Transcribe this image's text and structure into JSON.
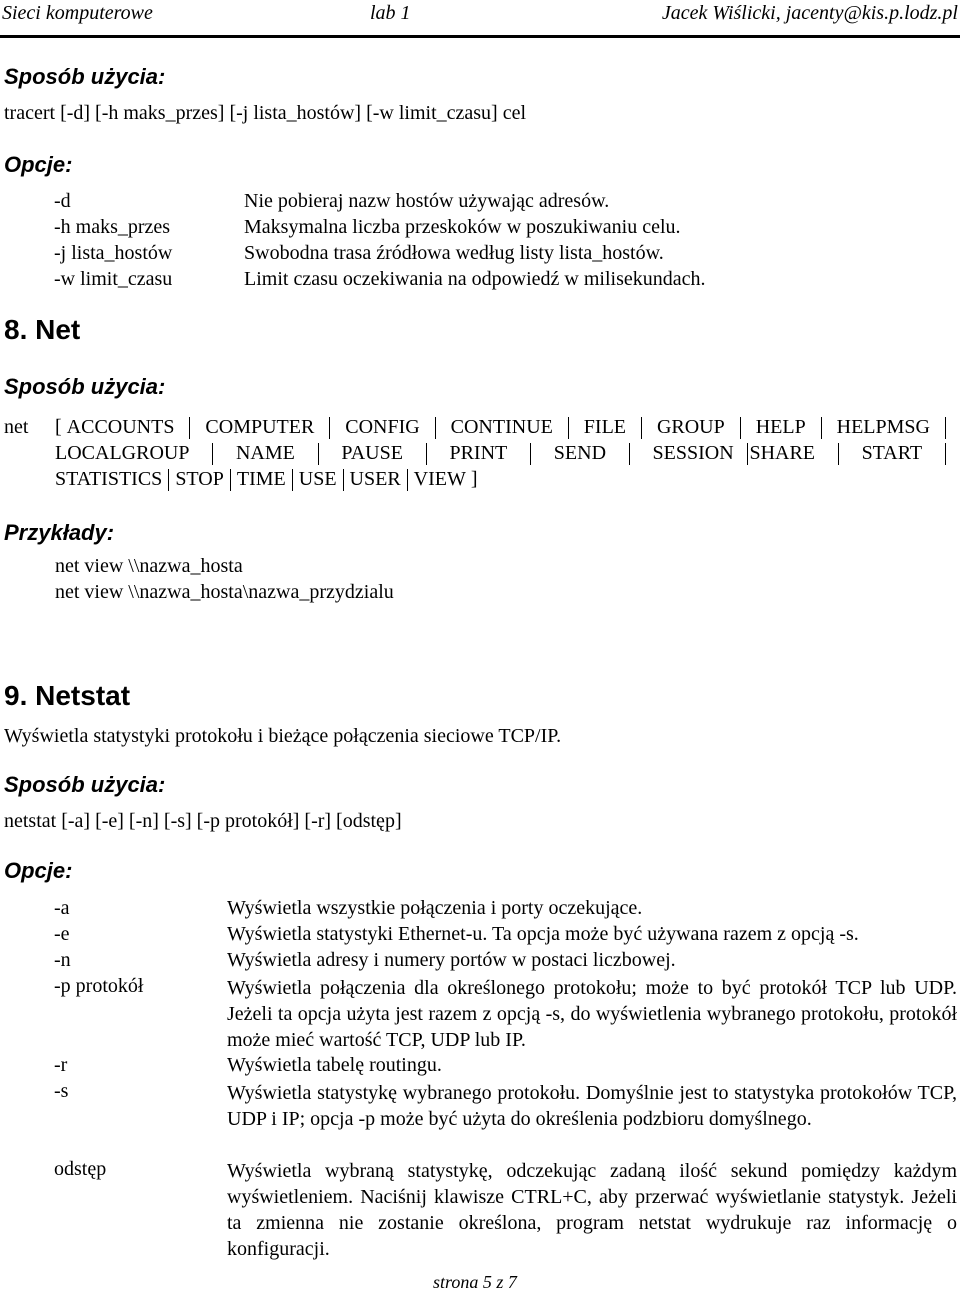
{
  "header": {
    "course": "Sieci komputerowe",
    "lab": "lab 1",
    "author": "Jacek Wiślicki, jacenty@kis.p.lodz.pl"
  },
  "tracert": {
    "usage_heading": "Sposób użycia:",
    "usage": "tracert [-d] [-h maks_przes] [-j lista_hostów] [-w limit_czasu] cel",
    "options_heading": "Opcje:",
    "options": [
      {
        "flag": "-d",
        "desc": "Nie pobieraj nazw hostów używając adresów."
      },
      {
        "flag": "-h maks_przes",
        "desc": "Maksymalna liczba przeskoków w poszukiwaniu celu."
      },
      {
        "flag": "-j lista_hostów",
        "desc": "Swobodna trasa źródłowa według listy lista_hostów."
      },
      {
        "flag": "-w limit_czasu",
        "desc": "Limit czasu oczekiwania na odpowiedź w milisekundach."
      }
    ]
  },
  "net": {
    "title": "8. Net",
    "usage_heading": "Sposób użycia:",
    "command": "net",
    "open_bracket": "[",
    "close_bracket": "]",
    "subcommands": [
      "ACCOUNTS",
      "COMPUTER",
      "CONFIG",
      "CONTINUE",
      "FILE",
      "GROUP",
      "HELP",
      "HELPMSG",
      "LOCALGROUP",
      "NAME",
      "PAUSE",
      "PRINT",
      "SEND",
      "SESSION",
      "SHARE",
      "START",
      "STATISTICS",
      "STOP",
      "TIME",
      "USE",
      "USER",
      "VIEW"
    ],
    "examples_heading": "Przykłady:",
    "examples": [
      "net view \\\\nazwa_hosta",
      "net view \\\\nazwa_hosta\\nazwa_przydzialu"
    ]
  },
  "netstat": {
    "title": "9. Netstat",
    "description": "Wyświetla statystyki protokołu i bieżące połączenia sieciowe TCP/IP.",
    "usage_heading": "Sposób użycia:",
    "usage": "netstat [-a] [-e] [-n] [-s] [-p protokół] [-r] [odstęp]",
    "options_heading": "Opcje:",
    "options": [
      {
        "flag": "-a",
        "desc": "Wyświetla wszystkie połączenia i porty oczekujące."
      },
      {
        "flag": "-e",
        "desc": "Wyświetla statystyki Ethernet-u. Ta opcja może być używana razem z opcją -s."
      },
      {
        "flag": "-n",
        "desc": "Wyświetla adresy i numery portów w postaci liczbowej."
      },
      {
        "flag": "-p protokół",
        "desc": "Wyświetla połączenia dla określonego protokołu; może to być protokół TCP lub UDP. Jeżeli ta opcja użyta jest razem z opcją  -s, do wyświetlenia wybranego protokołu, protokół może mieć wartość TCP, UDP lub IP."
      },
      {
        "flag": "-r",
        "desc": "Wyświetla tabelę routingu."
      },
      {
        "flag": "-s",
        "desc": "Wyświetla statystykę wybranego protokołu. Domyślnie jest to statystyka protokołów TCP, UDP i IP; opcja -p może być użyta do określenia podzbioru domyślnego."
      },
      {
        "flag": "odstęp",
        "desc": "Wyświetla wybraną statystykę, odczekując zadaną ilość sekund pomiędzy każdym wyświetleniem. Naciśnij klawisze CTRL+C, aby przerwać wyświetlanie statystyk. Jeżeli ta zmienna nie zostanie określona, program netstat wydrukuje raz informację o konfiguracji."
      }
    ]
  },
  "footer": {
    "page": "strona 5 z 7"
  }
}
